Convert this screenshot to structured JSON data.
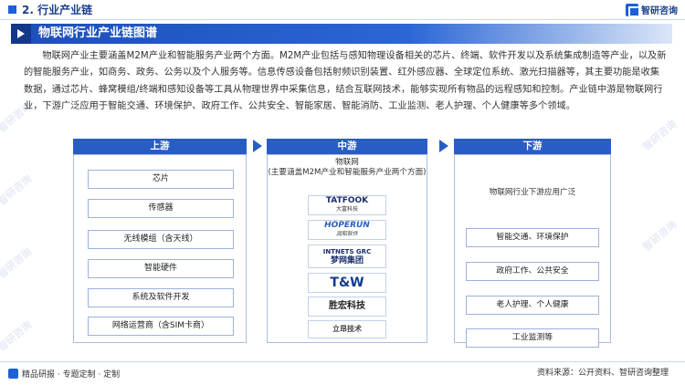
{
  "header": {
    "section": "2. 行业产业链",
    "brand": "智研咨询"
  },
  "banner": {
    "title": "物联网行业产业链图谱"
  },
  "intro": "物联网产业主要涵盖M2M产业和智能服务产业两个方面。M2M产业包括与感知物理设备相关的芯片、终端、软件开发以及系统集成制造等产业，以及新的智能服务产业，如商务、政务、公务以及个人服务等。信息传感设备包括射频识别装置、红外感应器、全球定位系统、激光扫描器等，其主要功能是收集数据，通过芯片、蜂窝模组/终端和感知设备等工具从物理世界中采集信息，结合互联网技术，能够实现所有物品的远程感知和控制。产业链中游是物联网行业，下游广泛应用于智能交通、环境保护、政府工作、公共安全、智能家居、智能消防、工业监测、老人护理、个人健康等多个领域。",
  "upstream": {
    "title": "上游",
    "items": [
      "芯片",
      "传感器",
      "无线模组（含天线）",
      "智能硬件",
      "系统及软件开发",
      "网络运营商（含SIM卡商）"
    ]
  },
  "midstream": {
    "title": "中游",
    "caption": "物联网\n(主要涵盖M2M产业和智能服务产业两个方面)",
    "logos": [
      {
        "name": "TATFOOK",
        "sub": "大富科技"
      },
      {
        "name": "HOPERUN",
        "sub": "润和软件"
      },
      {
        "name": "INTNETS GRC",
        "sub": "梦网集团"
      },
      {
        "name": "T&W",
        "sub": ""
      },
      {
        "name": "胜宏科技",
        "sub": ""
      },
      {
        "name": "立昂技术",
        "sub": ""
      }
    ]
  },
  "downstream": {
    "title": "下游",
    "caption": "物联网行业下游应用广泛",
    "items": [
      "智能交通、环境保护",
      "政府工作、公共安全",
      "老人护理、个人健康",
      "工业监测等"
    ]
  },
  "footer": {
    "left": "精品研报 · 专题定制 · 定制",
    "source": "资料来源：公开资料、智研咨询整理"
  },
  "colors": {
    "accent": "#2a5dc4",
    "dark": "#1c3f8c"
  },
  "watermark": "智研咨询"
}
